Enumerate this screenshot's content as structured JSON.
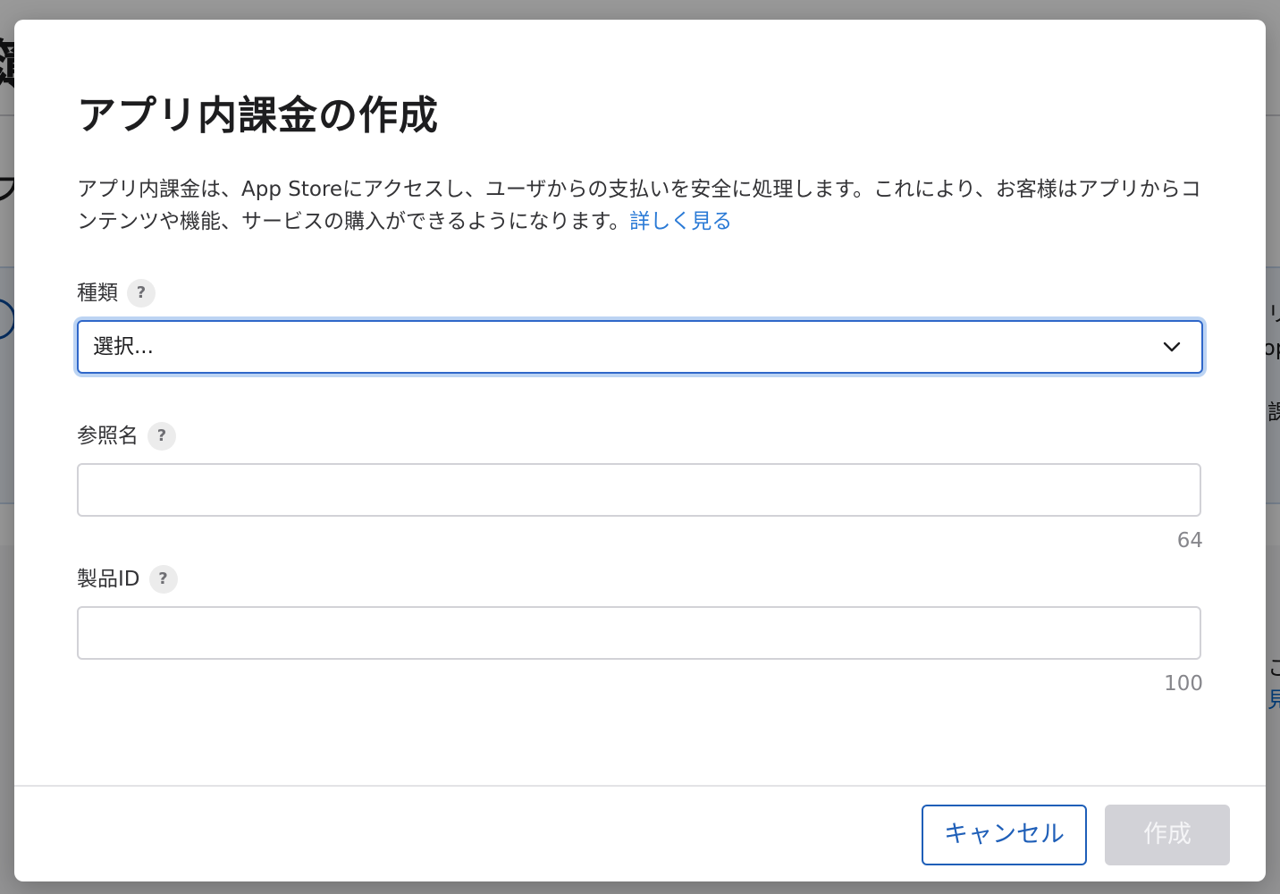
{
  "background": {
    "title_fragment": "簿",
    "subtitle_fragment": "フ",
    "right_fragments": [
      "リ",
      "op",
      "課",
      "こ",
      "見"
    ]
  },
  "modal": {
    "title": "アプリ内課金の作成",
    "description": "アプリ内課金は、App Storeにアクセスし、ユーザからの支払いを安全に処理します。これにより、お客様はアプリからコンテンツや機能、サービスの購入ができるようになります。",
    "learn_more": "詳しく見る",
    "fields": {
      "type": {
        "label": "種類",
        "help": "?",
        "selected": "選択...",
        "icon": "chevron-down-icon"
      },
      "reference_name": {
        "label": "参照名",
        "help": "?",
        "value": "",
        "max_length": "64"
      },
      "product_id": {
        "label": "製品ID",
        "help": "?",
        "value": "",
        "max_length": "100"
      }
    },
    "buttons": {
      "cancel": "キャンセル",
      "create": "作成"
    }
  },
  "colors": {
    "accent": "#1f5fb8",
    "focus_ring": "#bcd4f3",
    "link": "#2a7ad6",
    "disabled_button": "#d2d2d7"
  }
}
